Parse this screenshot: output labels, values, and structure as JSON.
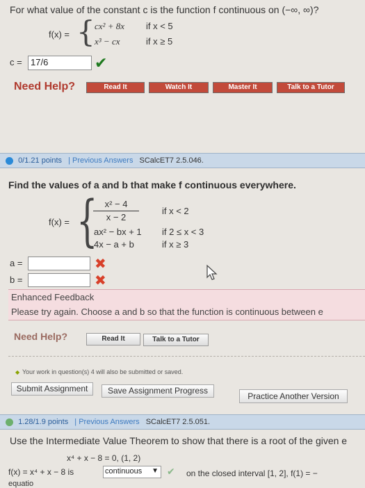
{
  "q1": {
    "question": "For what value of the constant c is the function f continuous on (−∞, ∞)?",
    "fx": "f(x) =",
    "piece1_expr": "cx² + 8x",
    "piece1_cond": "if x < 5",
    "piece2_expr": "x³ − cx",
    "piece2_cond": "if x ≥ 5",
    "c_label": "c =",
    "c_value": "17/6",
    "need_help": "Need Help?",
    "help_buttons": [
      "Read It",
      "Watch It",
      "Master It",
      "Talk to a Tutor"
    ],
    "help_colors": [
      "#c24a3a",
      "#c24a3a",
      "#c24a3a",
      "#c24a3a"
    ]
  },
  "q2": {
    "points": "0/1.21 points",
    "prev": "| Previous Answers",
    "source": "SCalcET7 2.5.046.",
    "question": "Find the values of a and b that make f continuous everywhere.",
    "fx": "f(x) =",
    "frac_num": "x² − 4",
    "frac_den": "x − 2",
    "piece1_cond": "if x < 2",
    "piece2_expr": "ax² − bx + 1",
    "piece2_cond": "if 2 ≤ x < 3",
    "piece3_expr": "4x − a + b",
    "piece3_cond": "if x ≥ 3",
    "a_label": "a =",
    "b_label": "b =",
    "a_value": "",
    "b_value": "",
    "feedback_title": "Enhanced Feedback",
    "feedback_text": "Please try again. Choose a and b so that the function is continuous between e",
    "need_help": "Need Help?",
    "help_buttons": [
      "Read It",
      "Talk to a Tutor"
    ],
    "saved_note": "Your work in question(s) 4 will also be submitted or saved.",
    "submit": "Submit Assignment",
    "save": "Save Assignment Progress",
    "practice": "Practice Another Version"
  },
  "q3": {
    "points": "1.28/1.9 points",
    "prev": "| Previous Answers",
    "source": "SCalcET7 2.5.051.",
    "question": "Use the Intermediate Value Theorem to show that there is a root of the given e",
    "equation": "x⁴ + x − 8 = 0,   (1, 2)",
    "fx_line": "f(x) = x⁴ + x − 8  is",
    "select_value": "continuous",
    "closed_text": "on the closed interval [1, 2], f(1) = −",
    "cut_text": "equatio"
  },
  "colors": {
    "check": "#1f7a1f",
    "cross": "#d8402a",
    "need_help": "#b03a2e",
    "link_blue": "#2a5d9a"
  }
}
